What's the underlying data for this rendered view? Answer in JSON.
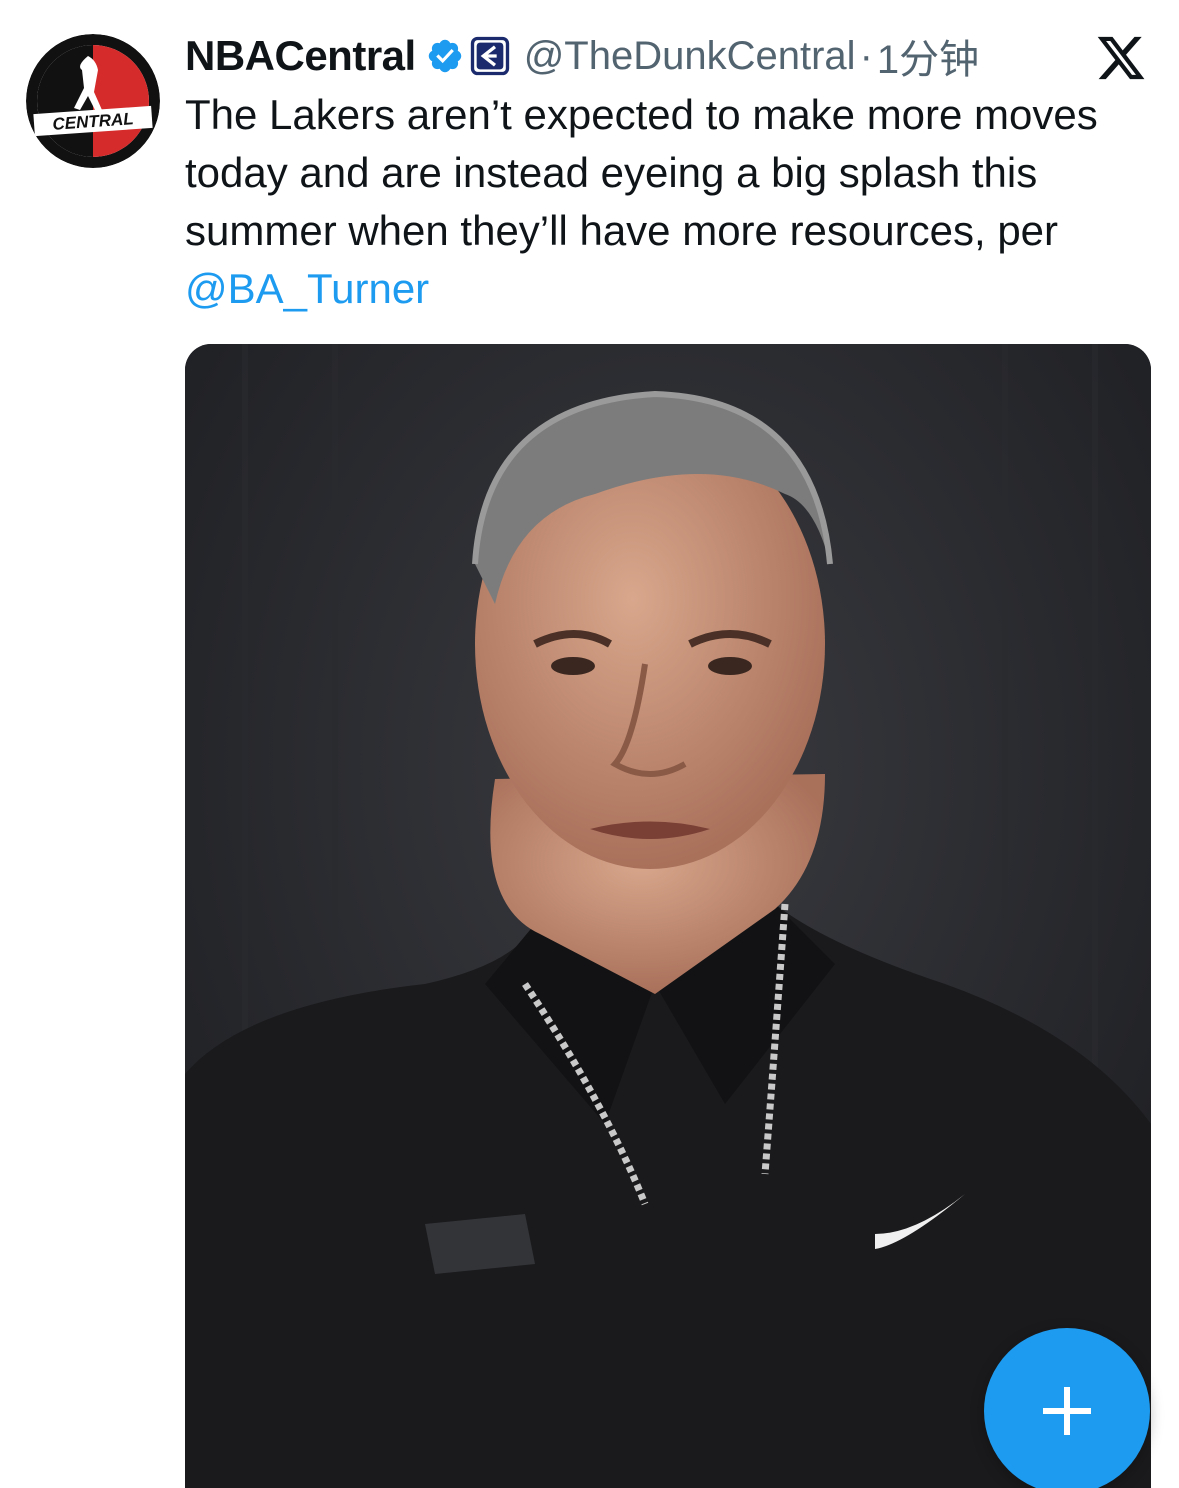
{
  "tweet": {
    "display_name": "NBACentral",
    "handle": "@TheDunkCentral",
    "separator": "·",
    "time": "1分钟",
    "text_before": "The Lakers aren’t expected to make more moves today and are instead eyeing a big splash this summer when they’ll have more resources, per ",
    "mention": "@BA_Turner"
  },
  "avatar": {
    "logo_text": "CENTRAL",
    "colors": {
      "ring": "#111111",
      "red": "#d62b2b",
      "white": "#ffffff"
    }
  },
  "icons": {
    "verified": "verified-badge-icon",
    "affiliate": "affiliate-badge-icon",
    "platform": "x-logo-icon",
    "compose": "plus-icon"
  },
  "colors": {
    "text": "#0f1419",
    "secondary": "#536471",
    "accent": "#1d9bf0"
  }
}
